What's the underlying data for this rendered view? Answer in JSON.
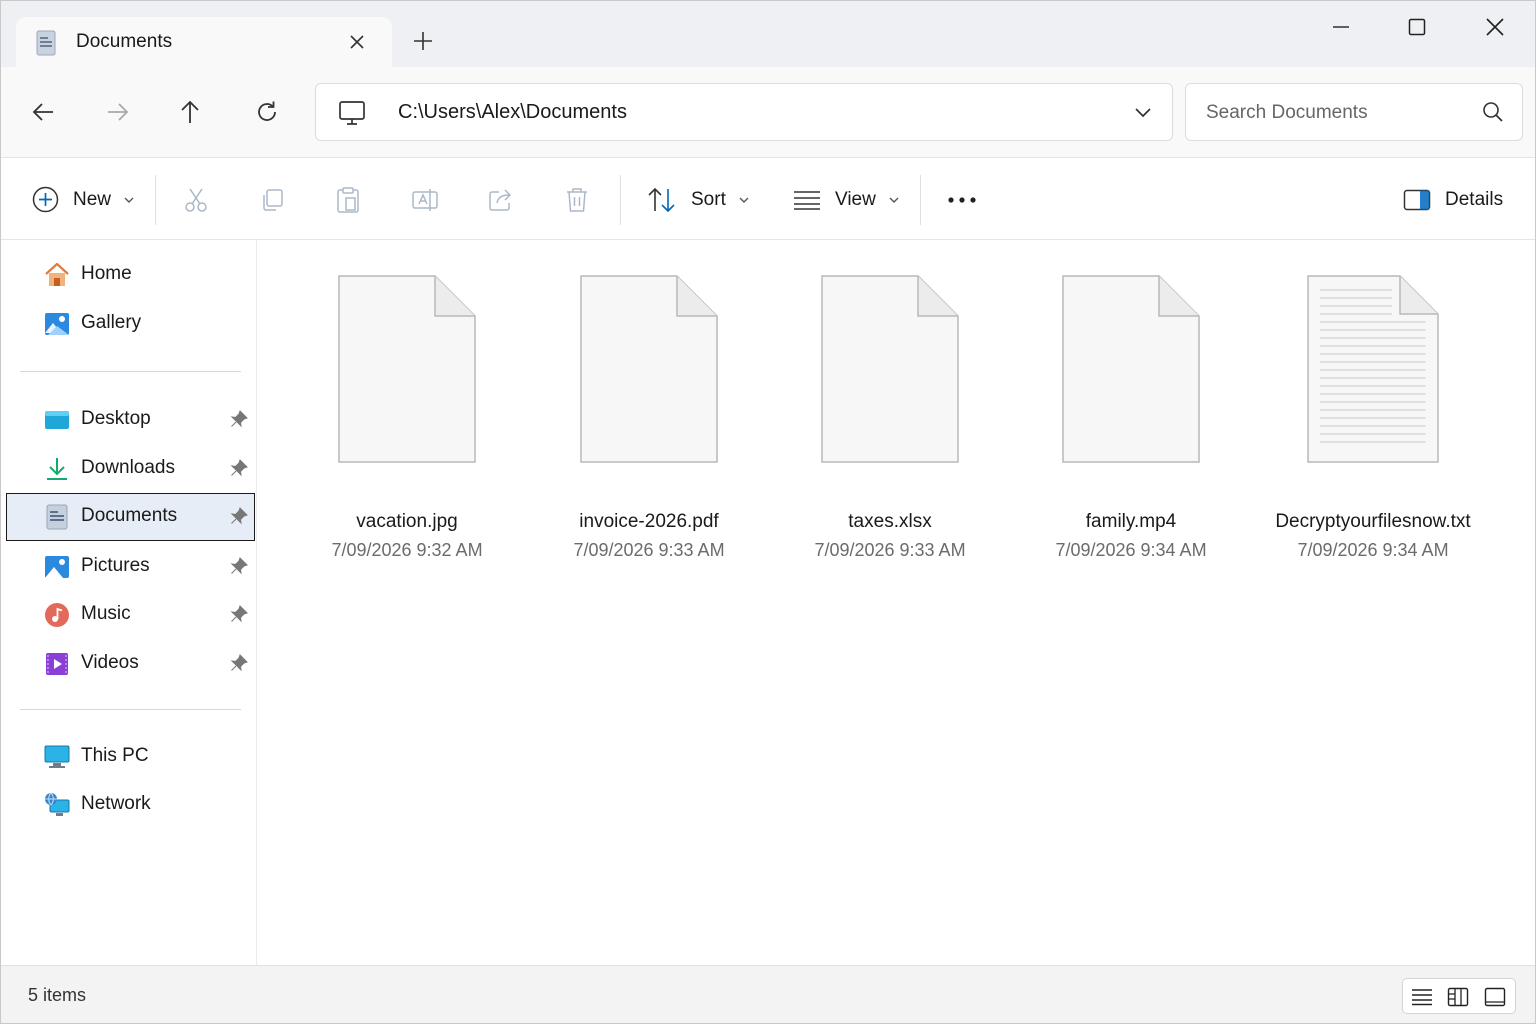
{
  "tab": {
    "title": "Documents"
  },
  "address": {
    "path": "C:\\Users\\Alex\\Documents"
  },
  "search": {
    "placeholder": "Search Documents"
  },
  "toolbar": {
    "new_label": "New",
    "sort_label": "Sort",
    "view_label": "View",
    "details_label": "Details"
  },
  "sidebar": {
    "quick": [
      {
        "label": "Home",
        "icon": "home-icon"
      },
      {
        "label": "Gallery",
        "icon": "gallery-icon"
      }
    ],
    "pinned": [
      {
        "label": "Desktop",
        "icon": "desktop-folder-icon"
      },
      {
        "label": "Downloads",
        "icon": "downloads-icon"
      },
      {
        "label": "Documents",
        "icon": "documents-icon",
        "selected": true
      },
      {
        "label": "Pictures",
        "icon": "pictures-icon"
      },
      {
        "label": "Music",
        "icon": "music-icon"
      },
      {
        "label": "Videos",
        "icon": "videos-icon"
      }
    ],
    "devices": [
      {
        "label": "This PC",
        "icon": "this-pc-icon"
      },
      {
        "label": "Network",
        "icon": "network-icon"
      }
    ]
  },
  "files": [
    {
      "name": "vacation.jpg",
      "date": "7/09/2026 9:32 AM",
      "icon": "blank-file-icon"
    },
    {
      "name": "invoice-2026.pdf",
      "date": "7/09/2026 9:33 AM",
      "icon": "blank-file-icon"
    },
    {
      "name": "taxes.xlsx",
      "date": "7/09/2026 9:33 AM",
      "icon": "blank-file-icon"
    },
    {
      "name": "family.mp4",
      "date": "7/09/2026 9:34 AM",
      "icon": "blank-file-icon"
    },
    {
      "name": "Decryptyourfilesnow.txt",
      "date": "7/09/2026 9:34 AM",
      "icon": "text-file-icon"
    }
  ],
  "status": {
    "items": "5 items"
  },
  "colors": {
    "accent": "#0067c0",
    "selected_bg": "#e6edf7",
    "titlebar": "#eef0f3"
  }
}
